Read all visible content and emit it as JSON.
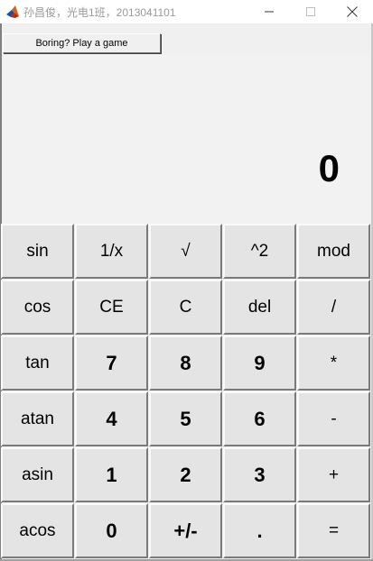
{
  "window": {
    "title": "孙昌俊，光电1班，2013041101",
    "controls": {
      "minimize_icon": "minimize-icon",
      "maximize_icon": "maximize-icon",
      "close_icon": "close-icon"
    }
  },
  "game_button": {
    "label": "Boring? Play a game"
  },
  "display": {
    "value": "0"
  },
  "keypad": {
    "rows": [
      [
        {
          "label": "sin",
          "style": "fn"
        },
        {
          "label": "1/x",
          "style": "fn"
        },
        {
          "label": "√",
          "style": "fn"
        },
        {
          "label": "^2",
          "style": "fn"
        },
        {
          "label": "mod",
          "style": "fn"
        }
      ],
      [
        {
          "label": "cos",
          "style": "fn"
        },
        {
          "label": "CE",
          "style": "fn"
        },
        {
          "label": "C",
          "style": "fn"
        },
        {
          "label": "del",
          "style": "fn"
        },
        {
          "label": "/",
          "style": "fn"
        }
      ],
      [
        {
          "label": "tan",
          "style": "fn"
        },
        {
          "label": "7",
          "style": "num"
        },
        {
          "label": "8",
          "style": "num"
        },
        {
          "label": "9",
          "style": "num"
        },
        {
          "label": "*",
          "style": "fn"
        }
      ],
      [
        {
          "label": "atan",
          "style": "fn"
        },
        {
          "label": "4",
          "style": "num"
        },
        {
          "label": "5",
          "style": "num"
        },
        {
          "label": "6",
          "style": "num"
        },
        {
          "label": "-",
          "style": "fn"
        }
      ],
      [
        {
          "label": "asin",
          "style": "fn"
        },
        {
          "label": "1",
          "style": "num"
        },
        {
          "label": "2",
          "style": "num"
        },
        {
          "label": "3",
          "style": "num"
        },
        {
          "label": "+",
          "style": "fn"
        }
      ],
      [
        {
          "label": "acos",
          "style": "fn"
        },
        {
          "label": "0",
          "style": "num"
        },
        {
          "label": "+/-",
          "style": "num"
        },
        {
          "label": ".",
          "style": "num"
        },
        {
          "label": "=",
          "style": "fn"
        }
      ]
    ]
  }
}
